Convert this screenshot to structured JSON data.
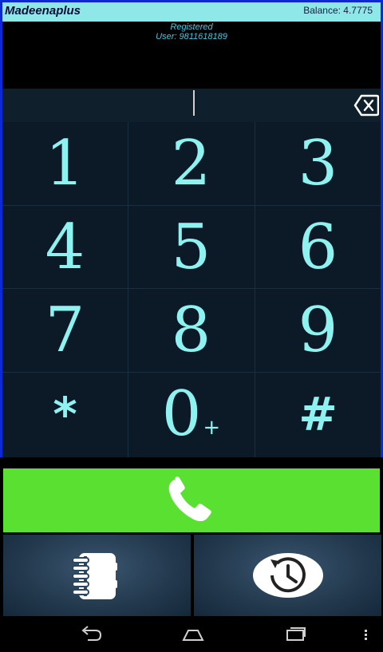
{
  "header": {
    "app_name": "Madeenaplus",
    "balance": "Balance: 4.7775"
  },
  "status": {
    "registration": "Registered",
    "user": "User: 9811618189"
  },
  "dial_input": {
    "value": ""
  },
  "keypad": {
    "keys": [
      "1",
      "2",
      "3",
      "4",
      "5",
      "6",
      "7",
      "8",
      "9",
      "*",
      "0",
      "#"
    ],
    "zero_sub": "+"
  },
  "colors": {
    "accent": "#8ef2f0",
    "call_green": "#5ae031",
    "frame_blue": "#0a2ad8"
  },
  "icons": {
    "backspace": "backspace-icon",
    "call": "phone-handset-icon",
    "contacts": "contacts-notebook-icon",
    "history": "call-history-icon",
    "nav_back": "back-icon",
    "nav_home": "home-icon",
    "nav_recents": "recents-icon",
    "nav_menu": "menu-icon"
  }
}
